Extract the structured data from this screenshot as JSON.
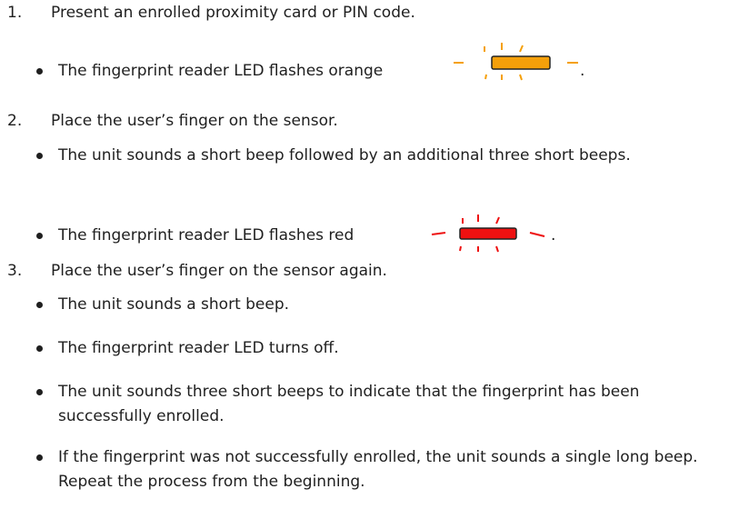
{
  "steps": [
    {
      "number": "1.",
      "text": "Present an enrolled proximity card or PIN code.",
      "bullets": [
        {
          "text": "The fingerprint reader LED flashes orange",
          "suffix": "."
        }
      ]
    },
    {
      "number": "2.",
      "text": "Place the user’s finger on the sensor.",
      "bullets": [
        {
          "text": "The unit sounds a short beep followed by an additional three short beeps."
        },
        {
          "text": "The fingerprint reader LED flashes red",
          "suffix": "."
        }
      ]
    },
    {
      "number": "3.",
      "text": "Place the user’s finger on the sensor again.",
      "bullets": [
        {
          "text": "The unit sounds a short beep."
        },
        {
          "text": "The fingerprint reader LED turns off."
        },
        {
          "text": "The unit sounds three short beeps to indicate that the fingerprint has been successfully enrolled."
        },
        {
          "text": "If the fingerprint was not successfully enrolled, the unit sounds a single long beep. Repeat the process from the beginning."
        }
      ]
    }
  ],
  "icons": {
    "orange_led": {
      "name": "led-flashing-orange-icon",
      "body_color": "#F5A00A",
      "ray_color": "#F5A00A"
    },
    "red_led": {
      "name": "led-flashing-red-icon",
      "body_color": "#EE1111",
      "ray_color": "#EE1111"
    }
  }
}
